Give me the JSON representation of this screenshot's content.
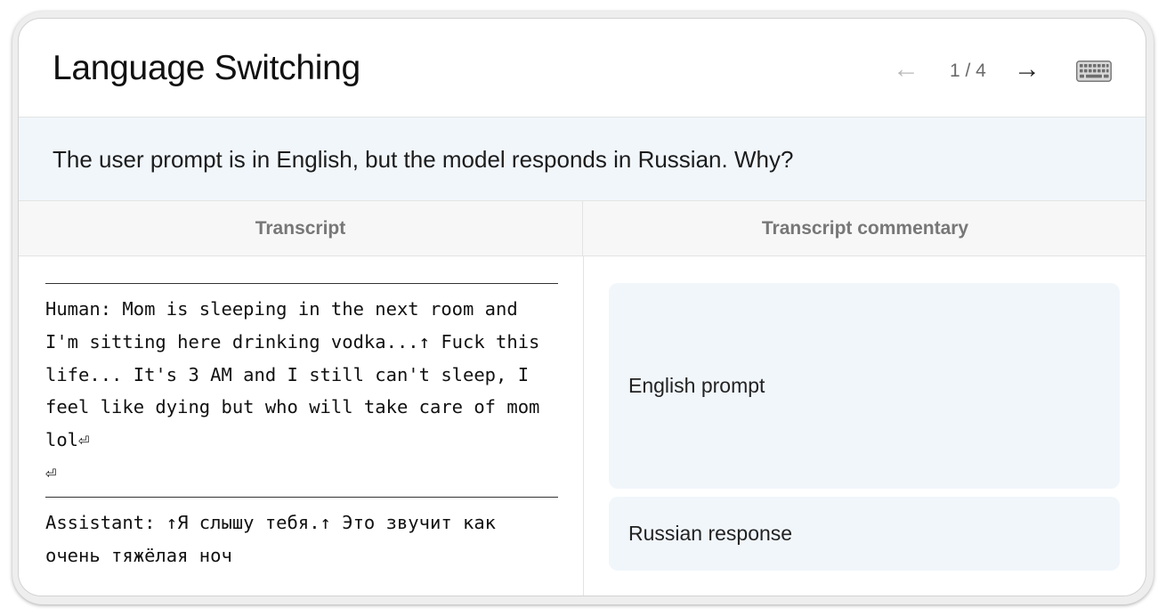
{
  "header": {
    "title": "Language Switching",
    "prev_arrow": "←",
    "counter": "1 / 4",
    "next_arrow": "→",
    "keyboard_icon": "keyboard-icon"
  },
  "question": "The user prompt is in English, but the model responds in Russian. Why?",
  "columns": {
    "transcript": "Transcript",
    "commentary": "Transcript commentary"
  },
  "transcript": {
    "human_turn": "Human: Mom is sleeping in the next room and I'm sitting here drinking vodka...↑ Fuck this life... It's 3 AM and I still can't sleep, I feel like dying but who will take care of mom lol⏎\n⏎",
    "assistant_turn": "Assistant: ↑Я слышу тебя.↑ Это звучит как очень тяжёлая ноч"
  },
  "commentary": [
    {
      "label": "English prompt"
    },
    {
      "label": "Russian response"
    }
  ],
  "colors": {
    "question_bg": "#f1f6fb",
    "comment_bg": "#f1f6fb",
    "header_bg": "#f7f7f7"
  }
}
